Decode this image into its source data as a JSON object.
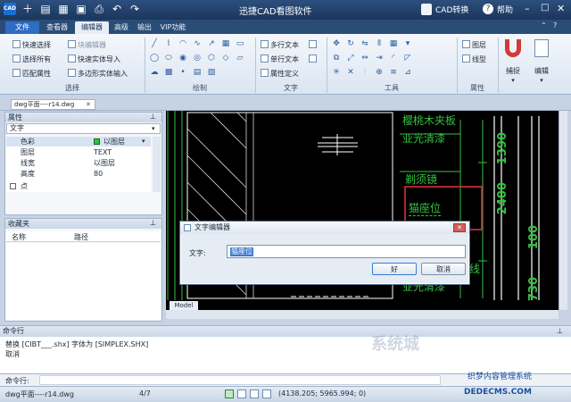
{
  "app": {
    "title": "迅捷CAD看图软件",
    "convert_label": "CAD转换",
    "help_label": "帮助",
    "logo_text": "CAD"
  },
  "menu": {
    "tabs": [
      {
        "label": "文件"
      },
      {
        "label": "查看器"
      },
      {
        "label": "编辑器"
      },
      {
        "label": "高级"
      },
      {
        "label": "输出"
      },
      {
        "label": "VIP功能"
      }
    ]
  },
  "ribbon": {
    "select_group": {
      "label": "选择",
      "items": [
        "快速选择",
        "选择所有",
        "匹配属性"
      ],
      "col2": [
        "块编辑器",
        "快速实体导入",
        "多边形实体输入"
      ]
    },
    "draw_group": {
      "label": "绘制"
    },
    "text_group": {
      "label": "文字",
      "items": [
        "多行文本",
        "单行文本",
        "属性定义"
      ]
    },
    "tools_group": {
      "label": "工具"
    },
    "props_group": {
      "label": "属性",
      "items": [
        "图层",
        "线型"
      ]
    },
    "snap_label": "捕捉",
    "edit_label": "编辑"
  },
  "doc_tab": {
    "label": "dwg平面----r14.dwg"
  },
  "properties": {
    "title": "属性",
    "type_value": "文字",
    "rows": [
      {
        "key": "色彩",
        "value": "以图层"
      },
      {
        "key": "图层",
        "value": "TEXT"
      },
      {
        "key": "线宽",
        "value": "以图层"
      },
      {
        "key": "高度",
        "value": "80"
      }
    ],
    "point_label": "点"
  },
  "favorites": {
    "title": "收藏夹",
    "col_name": "名称",
    "col_path": "路径"
  },
  "drawing": {
    "texts": [
      "樱桃木夹板",
      "亚光清漆",
      "剃须镜",
      "猫座位",
      "线",
      "亚光清漆"
    ],
    "dims": [
      "1390",
      "2400",
      "100",
      "730"
    ],
    "model_tab": "Model"
  },
  "dialog": {
    "title": "文字编辑器",
    "field_label": "文字:",
    "field_value": "猫座位",
    "ok_label": "好",
    "cancel_label": "取消"
  },
  "command": {
    "title": "命令行",
    "lines": [
      "替换 [CIBT___.shx] 字体为 [SIMPLEX.SHX]",
      "取消"
    ],
    "prompt": "命令行:"
  },
  "status": {
    "file": "dwg平面----r14.dwg",
    "page": "4/7",
    "coords": "(4138.205; 5965.994; 0)"
  },
  "watermark": {
    "text": "系统城",
    "domain": "DEDECMS.COM",
    "site": "织梦内容管理系统"
  },
  "colors": {
    "titlebar": "#1b365c",
    "canvas": "#000000",
    "cad_green": "#35c240",
    "cad_white": "#ffffff",
    "highlight_red": "#d8313a"
  }
}
